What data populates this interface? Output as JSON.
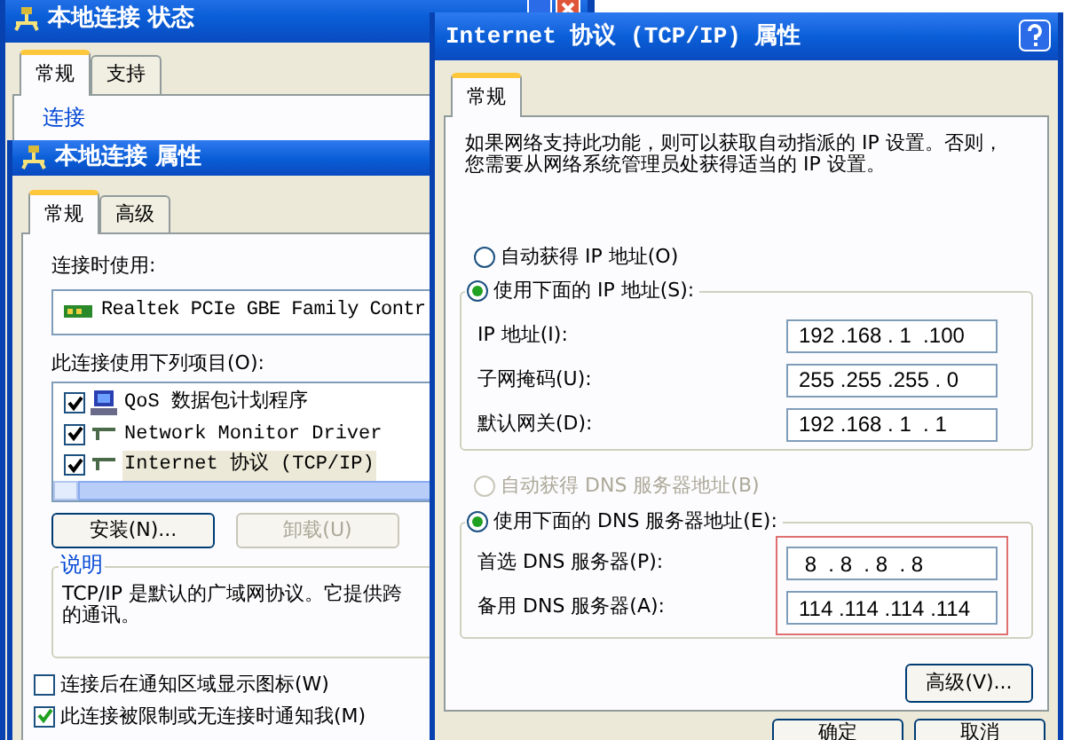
{
  "status_window": {
    "title": "本地连接 状态",
    "tabs": [
      {
        "label": "常规",
        "selected": true
      },
      {
        "label": "支持",
        "selected": false
      }
    ],
    "group_label": "连接"
  },
  "properties_window": {
    "title": "本地连接 属性",
    "tabs": [
      {
        "label": "常规",
        "selected": true
      },
      {
        "label": "高级",
        "selected": false
      }
    ],
    "connect_using_label": "连接时使用:",
    "adapter": "Realtek PCIe GBE Family Contr",
    "components_label": "此连接使用下列项目(O):",
    "components": [
      {
        "kind": "scheduler",
        "label": "QoS 数据包计划程序",
        "checked": true,
        "selected": false
      },
      {
        "kind": "protocol",
        "label": "Network Monitor Driver",
        "checked": true,
        "selected": false
      },
      {
        "kind": "protocol",
        "label": "Internet 协议 (TCP/IP)",
        "checked": true,
        "selected": true
      }
    ],
    "buttons": [
      {
        "label": "安装(N)...",
        "disabled": false
      },
      {
        "label": "卸载(U)",
        "disabled": true
      }
    ],
    "description_label": "说明",
    "description_lines": [
      "TCP/IP 是默认的广域网协议。它提供跨",
      "的通讯。"
    ],
    "options": [
      {
        "label": "连接后在通知区域显示图标(W)",
        "checked": false
      },
      {
        "label": "此连接被限制或无连接时通知我(M)",
        "checked": true
      }
    ]
  },
  "tcpip_window": {
    "title": "Internet 协议 (TCP/IP) 属性",
    "tabs": [
      {
        "label": "常规",
        "selected": true
      }
    ],
    "intro_lines": [
      "如果网络支持此功能，则可以获取自动指派的 IP 设置。否则，",
      "您需要从网络系统管理员处获得适当的 IP 设置。"
    ],
    "ip_mode": [
      {
        "label": "自动获得 IP 地址(O)",
        "selected": false,
        "disabled": false
      },
      {
        "label": "使用下面的 IP 地址(S):",
        "selected": true,
        "disabled": false
      }
    ],
    "ip_fields": [
      {
        "label": "IP 地址(I):",
        "value": "192 .168 . 1  .100"
      },
      {
        "label": "子网掩码(U):",
        "value": "255 .255 .255 . 0"
      },
      {
        "label": "默认网关(D):",
        "value": "192 .168 . 1  . 1"
      }
    ],
    "dns_mode": [
      {
        "label": "自动获得 DNS 服务器地址(B)",
        "selected": false,
        "disabled": true
      },
      {
        "label": "使用下面的 DNS 服务器地址(E):",
        "selected": true,
        "disabled": false
      }
    ],
    "dns_fields": [
      {
        "label": "首选 DNS 服务器(P):",
        "value": " 8  . 8  . 8  . 8"
      },
      {
        "label": "备用 DNS 服务器(A):",
        "value": "114 .114 .114 .114"
      }
    ],
    "dns_highlighted": true,
    "advanced_button": "高级(V)...",
    "buttons": [
      "确定",
      "取消"
    ]
  }
}
